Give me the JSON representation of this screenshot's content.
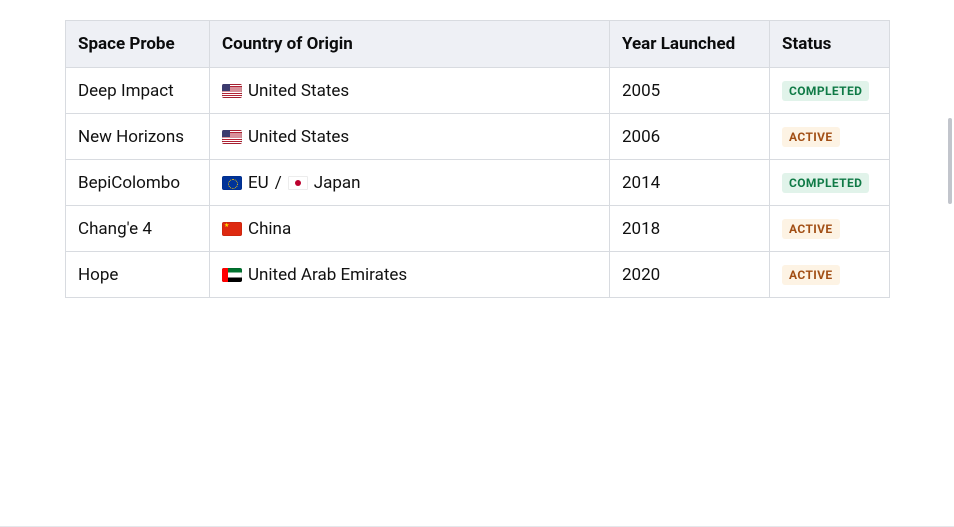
{
  "headers": {
    "probe": "Space Probe",
    "country": "Country of Origin",
    "year": "Year Launched",
    "status": "Status"
  },
  "status_labels": {
    "completed": "COMPLETED",
    "active": "ACTIVE"
  },
  "rows": [
    {
      "probe": "Deep Impact",
      "countries": [
        {
          "flag": "us",
          "name": "United States"
        }
      ],
      "year": "2005",
      "status": "completed"
    },
    {
      "probe": "New Horizons",
      "countries": [
        {
          "flag": "us",
          "name": "United States"
        }
      ],
      "year": "2006",
      "status": "active"
    },
    {
      "probe": "BepiColombo",
      "countries": [
        {
          "flag": "eu",
          "name": "EU"
        },
        {
          "flag": "jp",
          "name": "Japan"
        }
      ],
      "year": "2014",
      "status": "completed"
    },
    {
      "probe": "Chang'e 4",
      "countries": [
        {
          "flag": "cn",
          "name": "China"
        }
      ],
      "year": "2018",
      "status": "active"
    },
    {
      "probe": "Hope",
      "countries": [
        {
          "flag": "ae",
          "name": "United Arab Emirates"
        }
      ],
      "year": "2020",
      "status": "active"
    }
  ],
  "country_separator": " / "
}
